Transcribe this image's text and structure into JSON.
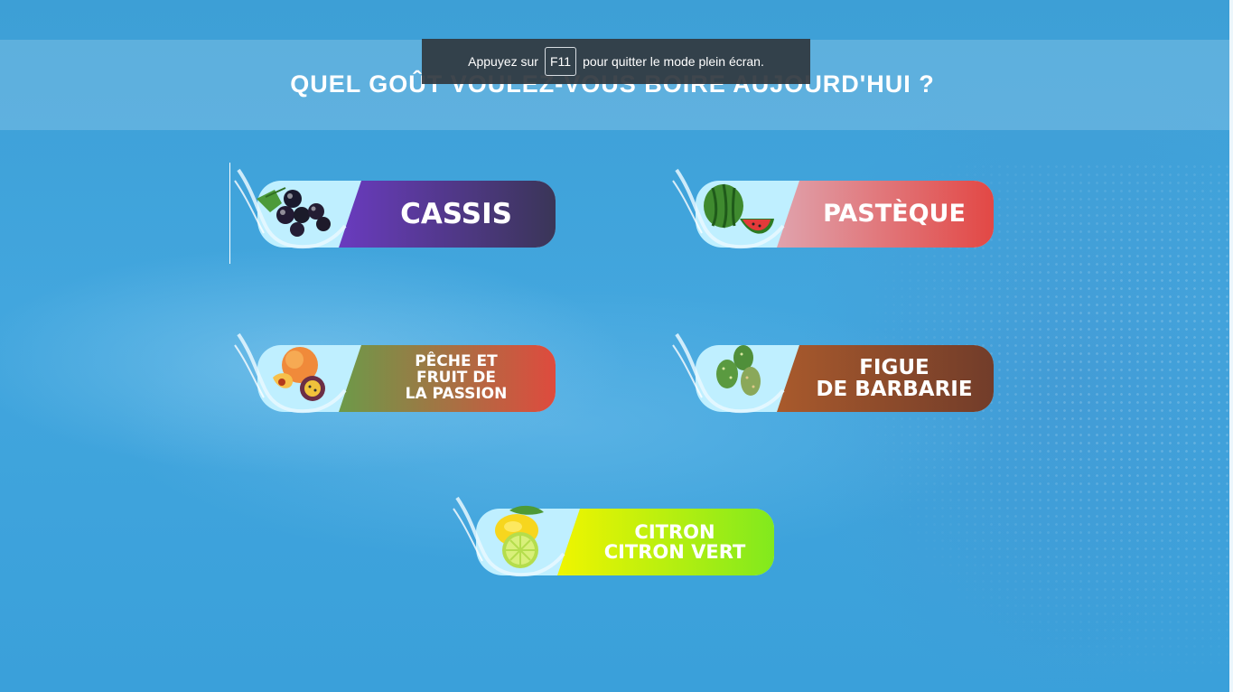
{
  "toast": {
    "before": "Appuyez sur",
    "key": "F11",
    "after": "pour quitter le mode plein écran."
  },
  "header": {
    "title": "QUEL GOÛT VOULEZ-VOUS BOIRE AUJOURD'HUI ?"
  },
  "flavors": [
    {
      "label": "CASSIS",
      "fruit_icon": "blackcurrant-icon",
      "gradient": [
        "#6a3bbf",
        "#36354f"
      ]
    },
    {
      "label": "PASTÈQUE",
      "fruit_icon": "watermelon-icon",
      "gradient": [
        "#e0a3ad",
        "#e2403c"
      ]
    },
    {
      "label": "PÊCHE ET\nFRUIT DE\nLA PASSION",
      "fruit_icon": "peach-passionfruit-icon",
      "gradient": [
        "#6c9a49",
        "#e8443d"
      ]
    },
    {
      "label": "FIGUE\nDE BARBARIE",
      "fruit_icon": "prickly-pear-icon",
      "gradient": [
        "#a95a2c",
        "#6d3a2a"
      ]
    },
    {
      "label": "CITRON\nCITRON VERT",
      "fruit_icon": "lemon-lime-icon",
      "gradient": [
        "#f0f500",
        "#78e820"
      ]
    }
  ]
}
